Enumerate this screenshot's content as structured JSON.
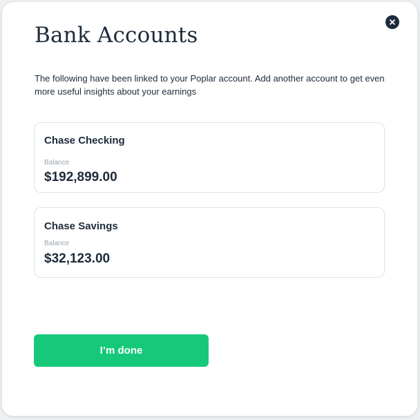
{
  "dialog": {
    "title": "Bank Accounts",
    "description": "The following have been linked to your Poplar account. Add another account to get even more useful insights about your earnings",
    "close_icon": "close-icon"
  },
  "accounts": [
    {
      "name": "Chase Checking",
      "balance_label": "Balance",
      "balance": "$192,899.00"
    },
    {
      "name": "Chase Savings",
      "balance_label": "Balance",
      "balance": "$32,123.00"
    }
  ],
  "actions": {
    "done_label": "I’m done"
  },
  "colors": {
    "primary_button": "#16c97a",
    "text_dark": "#1d2b3a",
    "muted_label": "#9aa3ad",
    "card_border": "#dfe3e8"
  }
}
